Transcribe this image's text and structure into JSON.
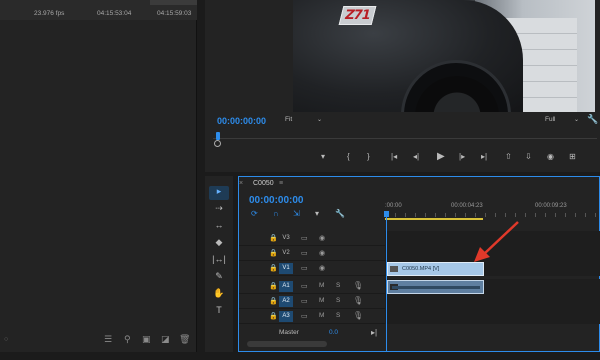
{
  "project": {
    "row": {
      "fps": "23.976 fps",
      "tc_in": "04:15:53:04",
      "tc_out": "04:15:59:03"
    },
    "footer_icons": [
      "list-icon",
      "search-icon",
      "new-bin-icon",
      "new-item-icon",
      "trash-icon"
    ],
    "footer_glyphs": {
      "list": "☰",
      "search": "⚲",
      "bin": "▣",
      "new_item": "◪",
      "trash": "🗑"
    }
  },
  "program_monitor": {
    "badge_text": "Z71",
    "timecode": "00:00:00:00",
    "fit_label": "Fit",
    "full_label": "Full",
    "chevron": "⌄",
    "wrench": "🔧",
    "controls": {
      "marker": "▾",
      "in_point": "{",
      "out_point": "}",
      "go_in": "|◂",
      "step_back": "◂|",
      "play": "▶",
      "step_fwd": "|▸",
      "go_out": "▸|",
      "lift": "⇧",
      "extract": "⇩",
      "export_frame": "◉",
      "button_editor": "⊞"
    }
  },
  "tools": [
    "▸",
    "⇢",
    "↔",
    "◆",
    "|↔|",
    "✎",
    "✋",
    "T"
  ],
  "timeline": {
    "sequence_name": "C0050",
    "close_glyph": "×",
    "menu_glyph": "≡",
    "timecode": "00:00:00:00",
    "tool_glyphs": [
      "⟳",
      "∩",
      "⇲",
      "▾",
      "🔧"
    ],
    "ruler_labels": [
      ":00:00",
      "00:00:04:23",
      "00:00:09:23"
    ],
    "tracks": [
      {
        "name": "V3",
        "type": "video",
        "active": false
      },
      {
        "name": "V2",
        "type": "video",
        "active": false
      },
      {
        "name": "V1",
        "type": "video",
        "active": true
      },
      {
        "name": "A1",
        "type": "audio",
        "active": true
      },
      {
        "name": "A2",
        "type": "audio",
        "active": true
      },
      {
        "name": "A3",
        "type": "audio",
        "active": true
      }
    ],
    "glyphs": {
      "lock": "🔒",
      "cam": "▭",
      "eye": "◉",
      "m": "M",
      "s": "S",
      "mic": "🎙"
    },
    "video_clip_label": "C0050.MP4 [V]",
    "master_label": "Master",
    "master_value": "0.0",
    "master_end_glyph": "▸|"
  },
  "annotation": {
    "arrow_color": "#e0392a"
  }
}
